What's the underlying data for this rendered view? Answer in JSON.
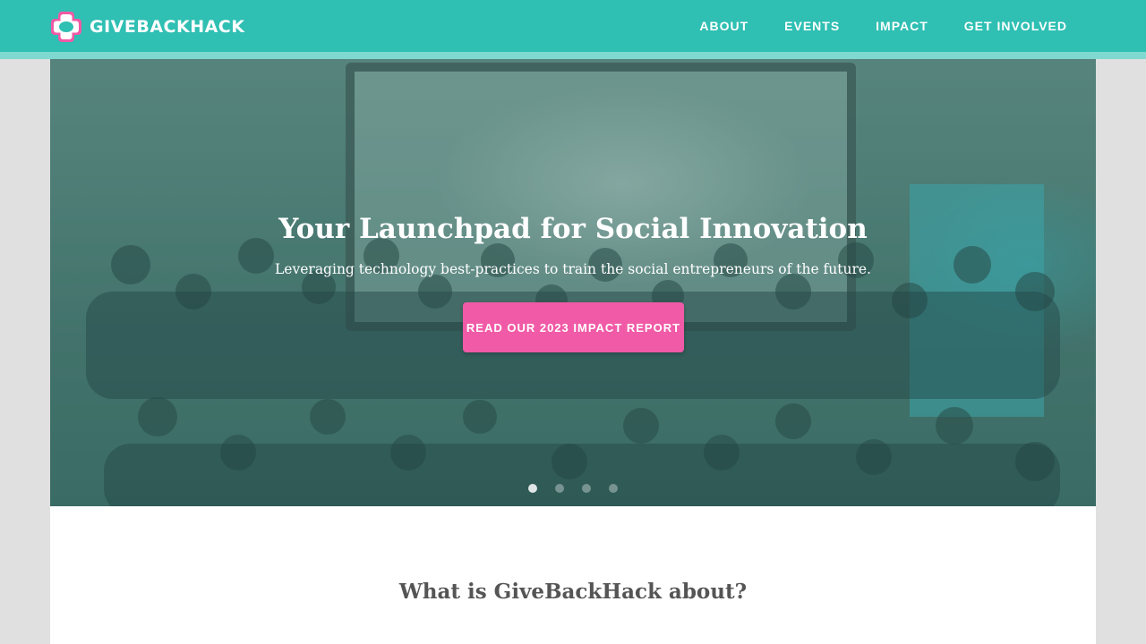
{
  "brand": {
    "name": "GIVEBACKHACK",
    "logo_icon": "giveback-logo-icon",
    "colors": {
      "primary": "#2fbfb3",
      "accent": "#f05aa6"
    }
  },
  "nav": {
    "items": [
      {
        "label": "ABOUT"
      },
      {
        "label": "EVENTS"
      },
      {
        "label": "IMPACT"
      },
      {
        "label": "GET INVOLVED"
      }
    ]
  },
  "hero": {
    "title": "Your Launchpad for Social Innovation",
    "subtitle": "Leveraging technology best-practices to train the social entrepreneurs of the future.",
    "cta_label": "READ OUR 2023 IMPACT REPORT",
    "slides": {
      "count": 4,
      "active_index": 0
    }
  },
  "about": {
    "title": "What is GiveBackHack about?"
  }
}
